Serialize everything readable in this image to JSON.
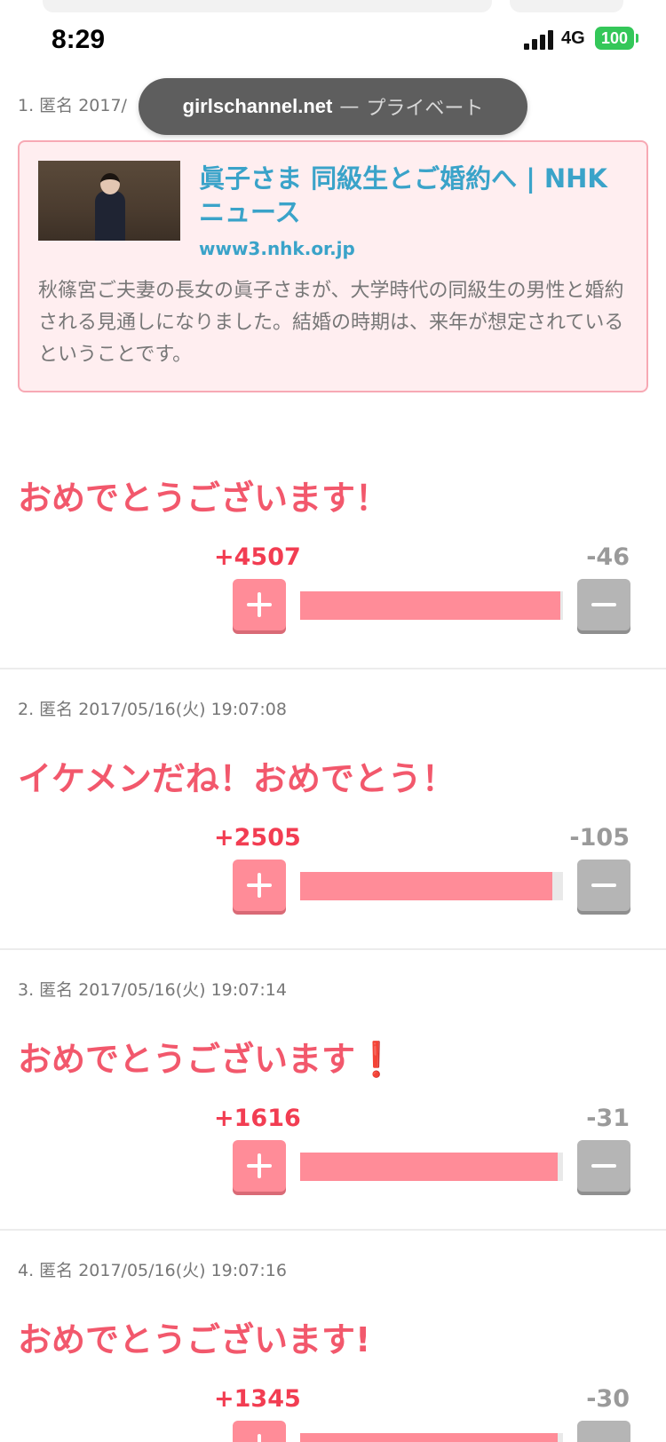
{
  "status_bar": {
    "time": "8:29",
    "network": "4G",
    "battery": "100"
  },
  "browser": {
    "host": "girlschannel.net",
    "separator": "—",
    "mode": "プライベート"
  },
  "comments": [
    {
      "number": "1.",
      "meta": "1. 匿名 2017/",
      "link": {
        "title": "眞子さま 同級生とご婚約へ | NHKニュース",
        "domain": "www3.nhk.or.jp",
        "description": "秋篠宮ご夫妻の長女の眞子さまが、大学時代の同級生の男性と婚約される見通しになりました。結婚の時期は、来年が想定されているということです。"
      },
      "body": "おめでとうございます！",
      "plus_label": "+4507",
      "minus_label": "-46",
      "plus": 4507,
      "minus": 46
    },
    {
      "number": "2.",
      "meta": "2. 匿名 2017/05/16(火) 19:07:08",
      "body": "イケメンだね！おめでとう！",
      "plus_label": "+2505",
      "minus_label": "-105",
      "plus": 2505,
      "minus": 105
    },
    {
      "number": "3.",
      "meta": "3. 匿名 2017/05/16(火) 19:07:14",
      "body": "おめでとうございます",
      "body_suffix": "❗",
      "plus_label": "+1616",
      "minus_label": "-31",
      "plus": 1616,
      "minus": 31
    },
    {
      "number": "4.",
      "meta": "4. 匿名 2017/05/16(火) 19:07:16",
      "body": "おめでとうございます!",
      "plus_label": "+1345",
      "minus_label": "-30",
      "plus": 1345,
      "minus": 30
    }
  ],
  "colors": {
    "accent": "#f2586c",
    "plus": "#ff8c98",
    "minus": "#b5b5b5",
    "link": "#3aa3c9"
  }
}
